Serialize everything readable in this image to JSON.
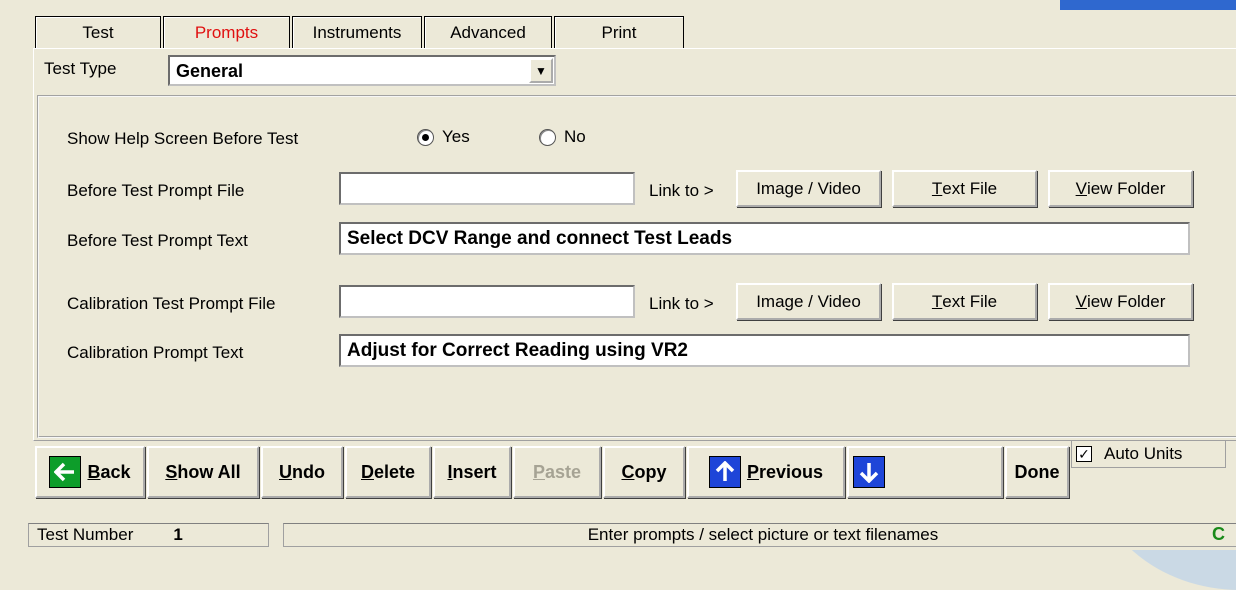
{
  "tabs": [
    {
      "label": "Test",
      "active": false
    },
    {
      "label": "Prompts",
      "active": true
    },
    {
      "label": "Instruments",
      "active": false
    },
    {
      "label": "Advanced",
      "active": false
    },
    {
      "label": "Print",
      "active": false
    }
  ],
  "test_type": {
    "label": "Test Type",
    "value": "General"
  },
  "help_screen": {
    "label": "Show Help Screen Before Test",
    "yes": "Yes",
    "no": "No",
    "selected": "Yes"
  },
  "before_prompt_file": {
    "label": "Before Test Prompt File",
    "value": "",
    "link_to": "Link to >",
    "image_video": "Image / Video",
    "text_file": "Text File",
    "view_folder": "View Folder"
  },
  "before_prompt_text": {
    "label": "Before Test Prompt Text",
    "value": "Select DCV Range and connect Test Leads"
  },
  "calib_prompt_file": {
    "label": "Calibration Test Prompt File",
    "value": "",
    "link_to": "Link to >",
    "image_video": "Image / Video",
    "text_file": "Text File",
    "view_folder": "View Folder"
  },
  "calib_prompt_text": {
    "label": "Calibration Prompt Text",
    "value": "Adjust for Correct Reading using VR2"
  },
  "toolbar": {
    "back": "Back",
    "show_all": "Show All",
    "undo": "Undo",
    "delete": "Delete",
    "insert": "Insert",
    "paste": "Paste",
    "copy": "Copy",
    "previous": "Previous",
    "done": "Done"
  },
  "auto_units": {
    "label": "Auto Units",
    "checked": true
  },
  "status": {
    "test_number_label": "Test Number",
    "test_number": "1",
    "message": "Enter prompts / select picture or text filenames",
    "indicator": "C"
  },
  "colors": {
    "active_tab": "#e01010",
    "back_icon": "#0d9d2a",
    "nav_icon": "#1e45d8",
    "indicator": "#1a8a1a"
  }
}
